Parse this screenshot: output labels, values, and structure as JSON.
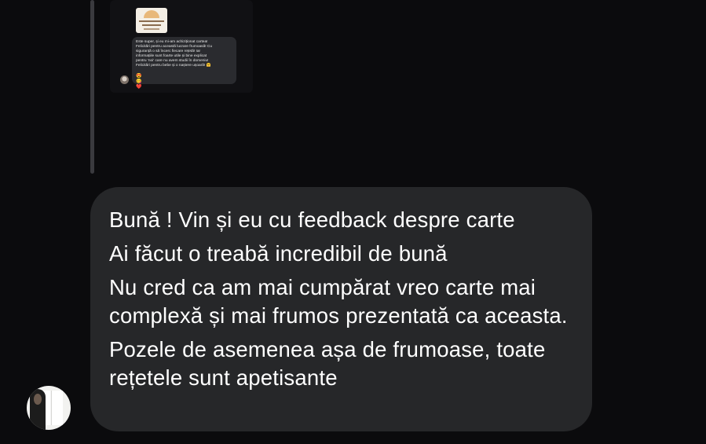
{
  "quoted_story": {
    "thumbnail_icon": "book-cover-thumbnail",
    "comment_lines": [
      "Este super, și eu mi-am achiziționat cartea!",
      "Felicitări pentru această lucrare frumoasă! Cu",
      "siguranță o să încerc fiecare rețetă! Iar",
      "informațiile sunt foarte utile și bine explicat",
      "pentru 'noi' care nu avem studii în domeniu!",
      "Felicitări pentru bebe și o naștere ușoară! 🤗"
    ],
    "reactions": [
      "😍",
      "😋",
      "❤️"
    ]
  },
  "message": {
    "paragraphs": [
      "Bună ! Vin și eu cu feedback despre carte",
      "Ai făcut o treabă incredibil de bună",
      "Nu cred ca am mai cumpărat vreo carte mai complexă și mai frumos prezentată ca aceasta.",
      "Pozele de asemenea așa de frumoase, toate rețetele sunt apetisante"
    ]
  },
  "colors": {
    "background": "#0b0b0d",
    "bubble": "#262729",
    "text": "#ffffff"
  }
}
